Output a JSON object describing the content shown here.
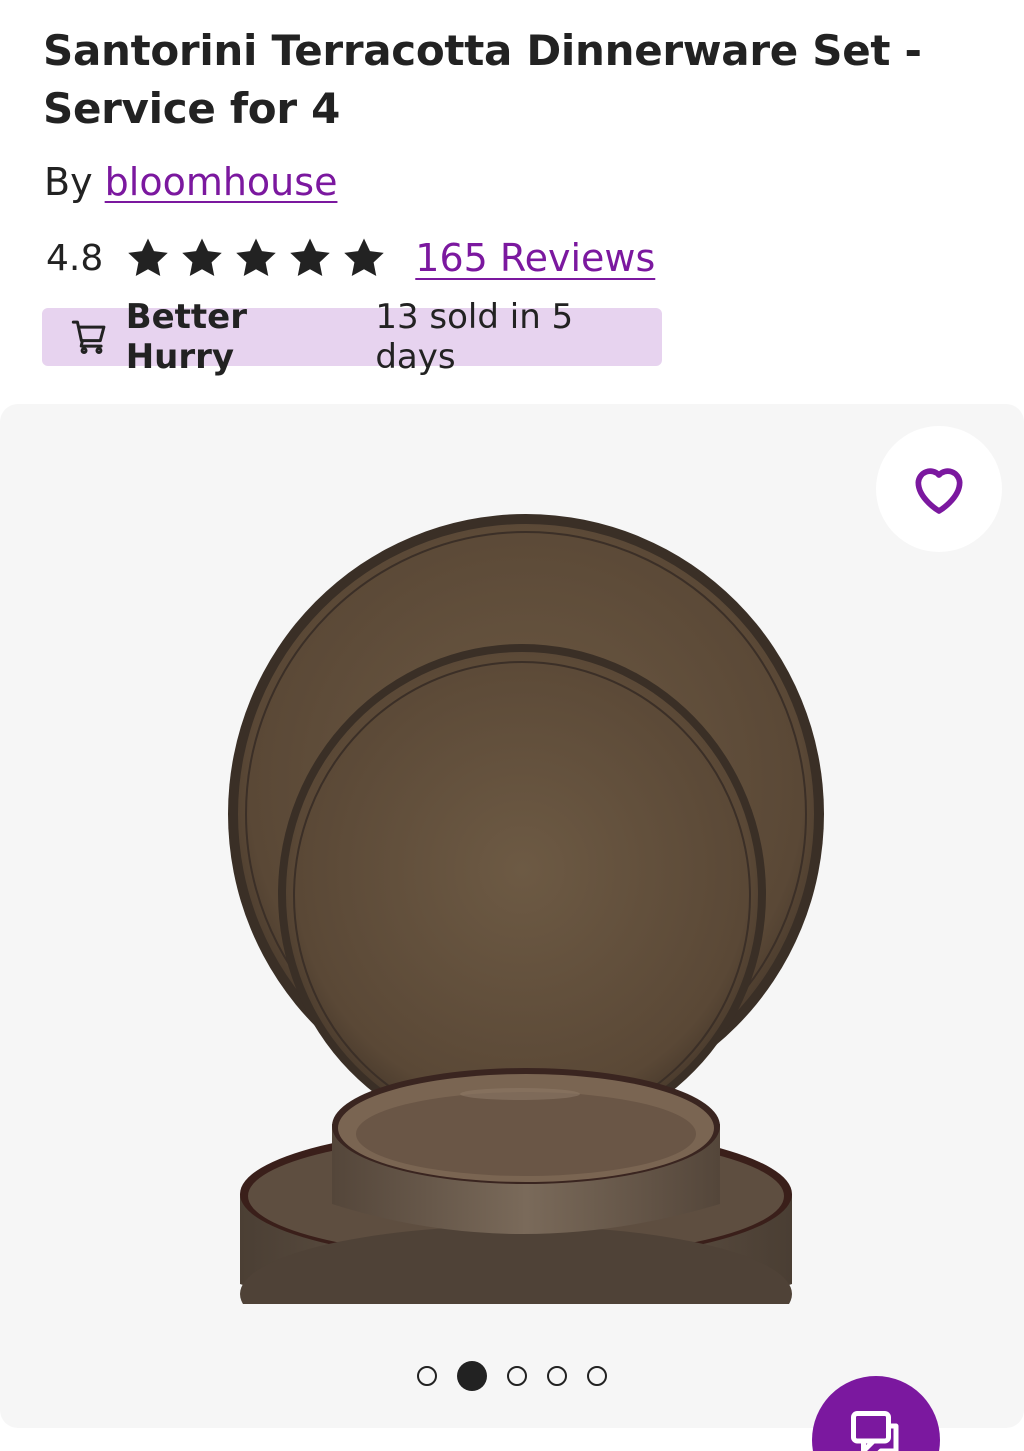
{
  "product": {
    "title": "Santorini Terracotta Dinnerware Set - Service for 4",
    "by_prefix": "By",
    "brand": "bloomhouse",
    "rating": "4.8",
    "rating_value": 4.8,
    "stars_total": 5,
    "reviews_label": "165 Reviews"
  },
  "badge": {
    "icon": "cart-icon",
    "strong": "Better Hurry",
    "text": "13 sold in 5 days"
  },
  "gallery": {
    "favorite_icon": "heart-icon",
    "image_alt": "brown stoneware dinner plate, salad plate and bowls",
    "dots_total": 5,
    "active_index": 1
  },
  "chat": {
    "icon": "chat-icon"
  },
  "colors": {
    "accent": "#7b189f",
    "badge_bg": "#e7d3ef",
    "text": "#222222",
    "gallery_bg": "#f6f6f6"
  }
}
